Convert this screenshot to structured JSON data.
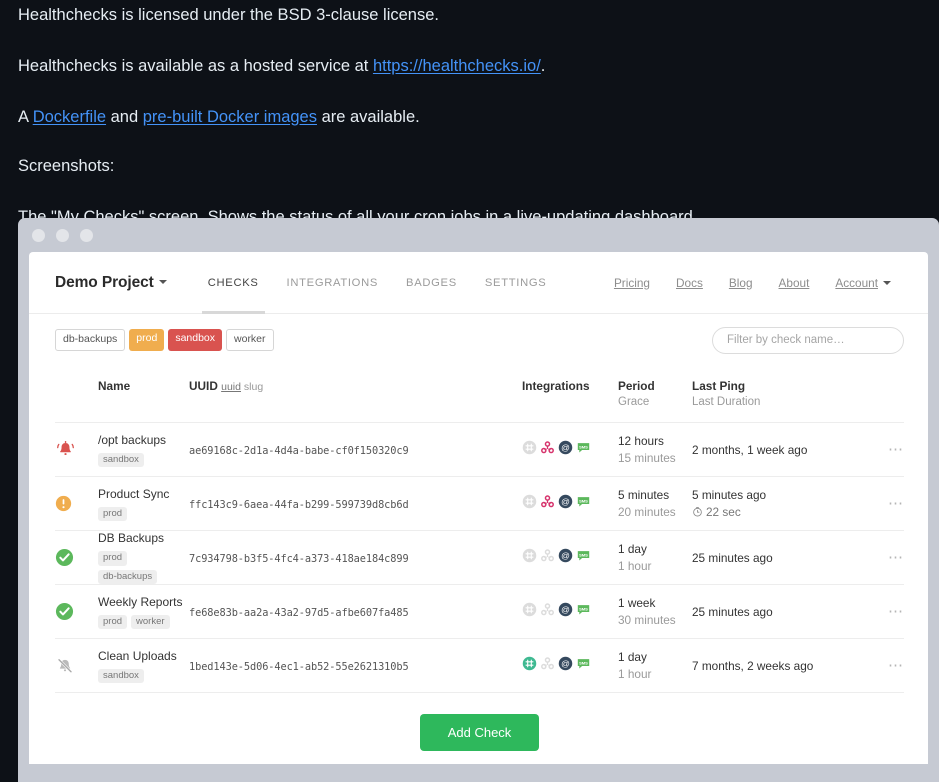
{
  "document": {
    "paragraphs": [
      {
        "id": "license",
        "parts": [
          {
            "text": "Healthchecks is licensed under the BSD 3-clause license."
          }
        ]
      },
      {
        "id": "hosted",
        "parts": [
          {
            "text": "Healthchecks is available as a hosted service at "
          },
          {
            "text": "https://healthchecks.io/",
            "link": true
          },
          {
            "text": "."
          }
        ]
      },
      {
        "id": "docker",
        "parts": [
          {
            "text": "A "
          },
          {
            "text": "Dockerfile",
            "link": true
          },
          {
            "text": " and "
          },
          {
            "text": "pre-built Docker images",
            "link": true
          },
          {
            "text": " are available."
          }
        ]
      },
      {
        "id": "screenshots",
        "parts": [
          {
            "text": "Screenshots:"
          }
        ]
      },
      {
        "id": "caption",
        "parts": [
          {
            "text": "The \"My Checks\" screen. Shows the status of all your cron jobs in a live-updating dashboard."
          }
        ]
      }
    ],
    "text": {
      "license": "Healthchecks is licensed under the BSD 3-clause license.",
      "hosted_prefix": "Healthchecks is available as a hosted service at ",
      "hosted_link": "https://healthchecks.io/",
      "hosted_suffix": ".",
      "docker_a": "A ",
      "docker_link1": "Dockerfile",
      "docker_and": " and ",
      "docker_link2": "pre-built Docker images",
      "docker_suffix": " are available.",
      "screenshots": "Screenshots:",
      "caption": "The \"My Checks\" screen. Shows the status of all your cron jobs in a live-updating dashboard."
    }
  },
  "app": {
    "navbar": {
      "project_name": "Demo Project",
      "tabs": [
        {
          "label": "CHECKS",
          "active": true
        },
        {
          "label": "INTEGRATIONS",
          "active": false
        },
        {
          "label": "BADGES",
          "active": false
        },
        {
          "label": "SETTINGS",
          "active": false
        }
      ],
      "links": [
        {
          "label": "Pricing"
        },
        {
          "label": "Docs"
        },
        {
          "label": "Blog"
        },
        {
          "label": "About"
        },
        {
          "label": "Account",
          "caret": true
        }
      ]
    },
    "filters": {
      "tags": [
        {
          "label": "db-backups",
          "style": "plain"
        },
        {
          "label": "prod",
          "style": "prod"
        },
        {
          "label": "sandbox",
          "style": "sandbox"
        },
        {
          "label": "worker",
          "style": "plain"
        }
      ],
      "search_placeholder": "Filter by check name…",
      "search_value": ""
    },
    "table": {
      "headers": {
        "name": "Name",
        "uuid": "UUID",
        "uuid_toggle_selected": "uuid",
        "uuid_toggle_other": "slug",
        "integrations": "Integrations",
        "period": "Period",
        "grace": "Grace",
        "last_ping": "Last Ping",
        "last_duration": "Last Duration",
        "menu": "⋯"
      },
      "rows": [
        {
          "status": "down",
          "name": "/opt backups",
          "tags": [
            "sandbox"
          ],
          "uuid": "ae69168c-2d1a-4d4a-babe-cf0f150320c9",
          "integrations": [
            "slack-off",
            "pushbullet-on",
            "email-on",
            "sms-on"
          ],
          "period": "12 hours",
          "grace": "15 minutes",
          "last_ping": "2 months, 1 week ago",
          "last_duration": "",
          "menu": "⋯"
        },
        {
          "status": "grace",
          "name": "Product Sync",
          "tags": [
            "prod"
          ],
          "uuid": "ffc143c9-6aea-44fa-b299-599739d8cb6d",
          "integrations": [
            "slack-off",
            "pushbullet-on",
            "email-on",
            "sms-on"
          ],
          "period": "5 minutes",
          "grace": "20 minutes",
          "last_ping": "5 minutes ago",
          "last_duration": "22 sec",
          "menu": "⋯"
        },
        {
          "status": "up",
          "name": "DB Backups",
          "tags": [
            "prod",
            "db-backups"
          ],
          "uuid": "7c934798-b3f5-4fc4-a373-418ae184c899",
          "integrations": [
            "slack-off",
            "pushbullet-off",
            "email-on",
            "sms-on"
          ],
          "period": "1 day",
          "grace": "1 hour",
          "last_ping": "25 minutes ago",
          "last_duration": "",
          "menu": "⋯"
        },
        {
          "status": "up",
          "name": "Weekly Reports",
          "tags": [
            "prod",
            "worker"
          ],
          "uuid": "fe68e83b-aa2a-43a2-97d5-afbe607fa485",
          "integrations": [
            "slack-off",
            "pushbullet-off",
            "email-on",
            "sms-on"
          ],
          "period": "1 week",
          "grace": "30 minutes",
          "last_ping": "25 minutes ago",
          "last_duration": "",
          "menu": "⋯"
        },
        {
          "status": "paused",
          "name": "Clean Uploads",
          "tags": [
            "sandbox"
          ],
          "uuid": "1bed143e-5d06-4ec1-ab52-55e2621310b5",
          "integrations": [
            "slack-on",
            "pushbullet-off",
            "email-on",
            "sms-on"
          ],
          "period": "1 day",
          "grace": "1 hour",
          "last_ping": "7 months, 2 weeks ago",
          "last_duration": "",
          "menu": "⋯"
        }
      ]
    },
    "add_check_label": "Add Check"
  },
  "colors": {
    "page_bg": "#0d1117",
    "link": "#4493f8",
    "status_down": "#d9534f",
    "status_grace": "#f0ad4e",
    "status_up": "#5cb85c",
    "status_paused": "#bbbbbb",
    "tag_prod": "#f0ad4e",
    "tag_sandbox": "#d9534f",
    "add_button": "#2eb85c",
    "sms_green": "#5cb85c",
    "email_navy": "#35495e",
    "pushbullet_pink": "#d6336c",
    "chrome_bg": "#c6cad3"
  }
}
